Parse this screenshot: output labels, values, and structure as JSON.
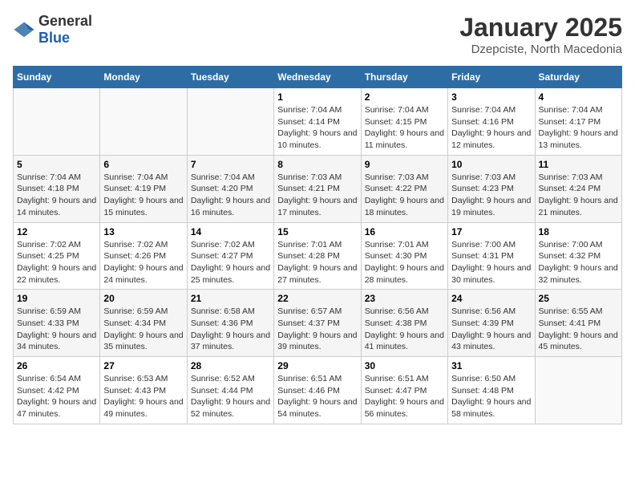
{
  "header": {
    "logo_general": "General",
    "logo_blue": "Blue",
    "title": "January 2025",
    "subtitle": "Dzepciste, North Macedonia"
  },
  "weekdays": [
    "Sunday",
    "Monday",
    "Tuesday",
    "Wednesday",
    "Thursday",
    "Friday",
    "Saturday"
  ],
  "weeks": [
    [
      {
        "day": "",
        "sunrise": "",
        "sunset": "",
        "daylight": ""
      },
      {
        "day": "",
        "sunrise": "",
        "sunset": "",
        "daylight": ""
      },
      {
        "day": "",
        "sunrise": "",
        "sunset": "",
        "daylight": ""
      },
      {
        "day": "1",
        "sunrise": "Sunrise: 7:04 AM",
        "sunset": "Sunset: 4:14 PM",
        "daylight": "Daylight: 9 hours and 10 minutes."
      },
      {
        "day": "2",
        "sunrise": "Sunrise: 7:04 AM",
        "sunset": "Sunset: 4:15 PM",
        "daylight": "Daylight: 9 hours and 11 minutes."
      },
      {
        "day": "3",
        "sunrise": "Sunrise: 7:04 AM",
        "sunset": "Sunset: 4:16 PM",
        "daylight": "Daylight: 9 hours and 12 minutes."
      },
      {
        "day": "4",
        "sunrise": "Sunrise: 7:04 AM",
        "sunset": "Sunset: 4:17 PM",
        "daylight": "Daylight: 9 hours and 13 minutes."
      }
    ],
    [
      {
        "day": "5",
        "sunrise": "Sunrise: 7:04 AM",
        "sunset": "Sunset: 4:18 PM",
        "daylight": "Daylight: 9 hours and 14 minutes."
      },
      {
        "day": "6",
        "sunrise": "Sunrise: 7:04 AM",
        "sunset": "Sunset: 4:19 PM",
        "daylight": "Daylight: 9 hours and 15 minutes."
      },
      {
        "day": "7",
        "sunrise": "Sunrise: 7:04 AM",
        "sunset": "Sunset: 4:20 PM",
        "daylight": "Daylight: 9 hours and 16 minutes."
      },
      {
        "day": "8",
        "sunrise": "Sunrise: 7:03 AM",
        "sunset": "Sunset: 4:21 PM",
        "daylight": "Daylight: 9 hours and 17 minutes."
      },
      {
        "day": "9",
        "sunrise": "Sunrise: 7:03 AM",
        "sunset": "Sunset: 4:22 PM",
        "daylight": "Daylight: 9 hours and 18 minutes."
      },
      {
        "day": "10",
        "sunrise": "Sunrise: 7:03 AM",
        "sunset": "Sunset: 4:23 PM",
        "daylight": "Daylight: 9 hours and 19 minutes."
      },
      {
        "day": "11",
        "sunrise": "Sunrise: 7:03 AM",
        "sunset": "Sunset: 4:24 PM",
        "daylight": "Daylight: 9 hours and 21 minutes."
      }
    ],
    [
      {
        "day": "12",
        "sunrise": "Sunrise: 7:02 AM",
        "sunset": "Sunset: 4:25 PM",
        "daylight": "Daylight: 9 hours and 22 minutes."
      },
      {
        "day": "13",
        "sunrise": "Sunrise: 7:02 AM",
        "sunset": "Sunset: 4:26 PM",
        "daylight": "Daylight: 9 hours and 24 minutes."
      },
      {
        "day": "14",
        "sunrise": "Sunrise: 7:02 AM",
        "sunset": "Sunset: 4:27 PM",
        "daylight": "Daylight: 9 hours and 25 minutes."
      },
      {
        "day": "15",
        "sunrise": "Sunrise: 7:01 AM",
        "sunset": "Sunset: 4:28 PM",
        "daylight": "Daylight: 9 hours and 27 minutes."
      },
      {
        "day": "16",
        "sunrise": "Sunrise: 7:01 AM",
        "sunset": "Sunset: 4:30 PM",
        "daylight": "Daylight: 9 hours and 28 minutes."
      },
      {
        "day": "17",
        "sunrise": "Sunrise: 7:00 AM",
        "sunset": "Sunset: 4:31 PM",
        "daylight": "Daylight: 9 hours and 30 minutes."
      },
      {
        "day": "18",
        "sunrise": "Sunrise: 7:00 AM",
        "sunset": "Sunset: 4:32 PM",
        "daylight": "Daylight: 9 hours and 32 minutes."
      }
    ],
    [
      {
        "day": "19",
        "sunrise": "Sunrise: 6:59 AM",
        "sunset": "Sunset: 4:33 PM",
        "daylight": "Daylight: 9 hours and 34 minutes."
      },
      {
        "day": "20",
        "sunrise": "Sunrise: 6:59 AM",
        "sunset": "Sunset: 4:34 PM",
        "daylight": "Daylight: 9 hours and 35 minutes."
      },
      {
        "day": "21",
        "sunrise": "Sunrise: 6:58 AM",
        "sunset": "Sunset: 4:36 PM",
        "daylight": "Daylight: 9 hours and 37 minutes."
      },
      {
        "day": "22",
        "sunrise": "Sunrise: 6:57 AM",
        "sunset": "Sunset: 4:37 PM",
        "daylight": "Daylight: 9 hours and 39 minutes."
      },
      {
        "day": "23",
        "sunrise": "Sunrise: 6:56 AM",
        "sunset": "Sunset: 4:38 PM",
        "daylight": "Daylight: 9 hours and 41 minutes."
      },
      {
        "day": "24",
        "sunrise": "Sunrise: 6:56 AM",
        "sunset": "Sunset: 4:39 PM",
        "daylight": "Daylight: 9 hours and 43 minutes."
      },
      {
        "day": "25",
        "sunrise": "Sunrise: 6:55 AM",
        "sunset": "Sunset: 4:41 PM",
        "daylight": "Daylight: 9 hours and 45 minutes."
      }
    ],
    [
      {
        "day": "26",
        "sunrise": "Sunrise: 6:54 AM",
        "sunset": "Sunset: 4:42 PM",
        "daylight": "Daylight: 9 hours and 47 minutes."
      },
      {
        "day": "27",
        "sunrise": "Sunrise: 6:53 AM",
        "sunset": "Sunset: 4:43 PM",
        "daylight": "Daylight: 9 hours and 49 minutes."
      },
      {
        "day": "28",
        "sunrise": "Sunrise: 6:52 AM",
        "sunset": "Sunset: 4:44 PM",
        "daylight": "Daylight: 9 hours and 52 minutes."
      },
      {
        "day": "29",
        "sunrise": "Sunrise: 6:51 AM",
        "sunset": "Sunset: 4:46 PM",
        "daylight": "Daylight: 9 hours and 54 minutes."
      },
      {
        "day": "30",
        "sunrise": "Sunrise: 6:51 AM",
        "sunset": "Sunset: 4:47 PM",
        "daylight": "Daylight: 9 hours and 56 minutes."
      },
      {
        "day": "31",
        "sunrise": "Sunrise: 6:50 AM",
        "sunset": "Sunset: 4:48 PM",
        "daylight": "Daylight: 9 hours and 58 minutes."
      },
      {
        "day": "",
        "sunrise": "",
        "sunset": "",
        "daylight": ""
      }
    ]
  ]
}
